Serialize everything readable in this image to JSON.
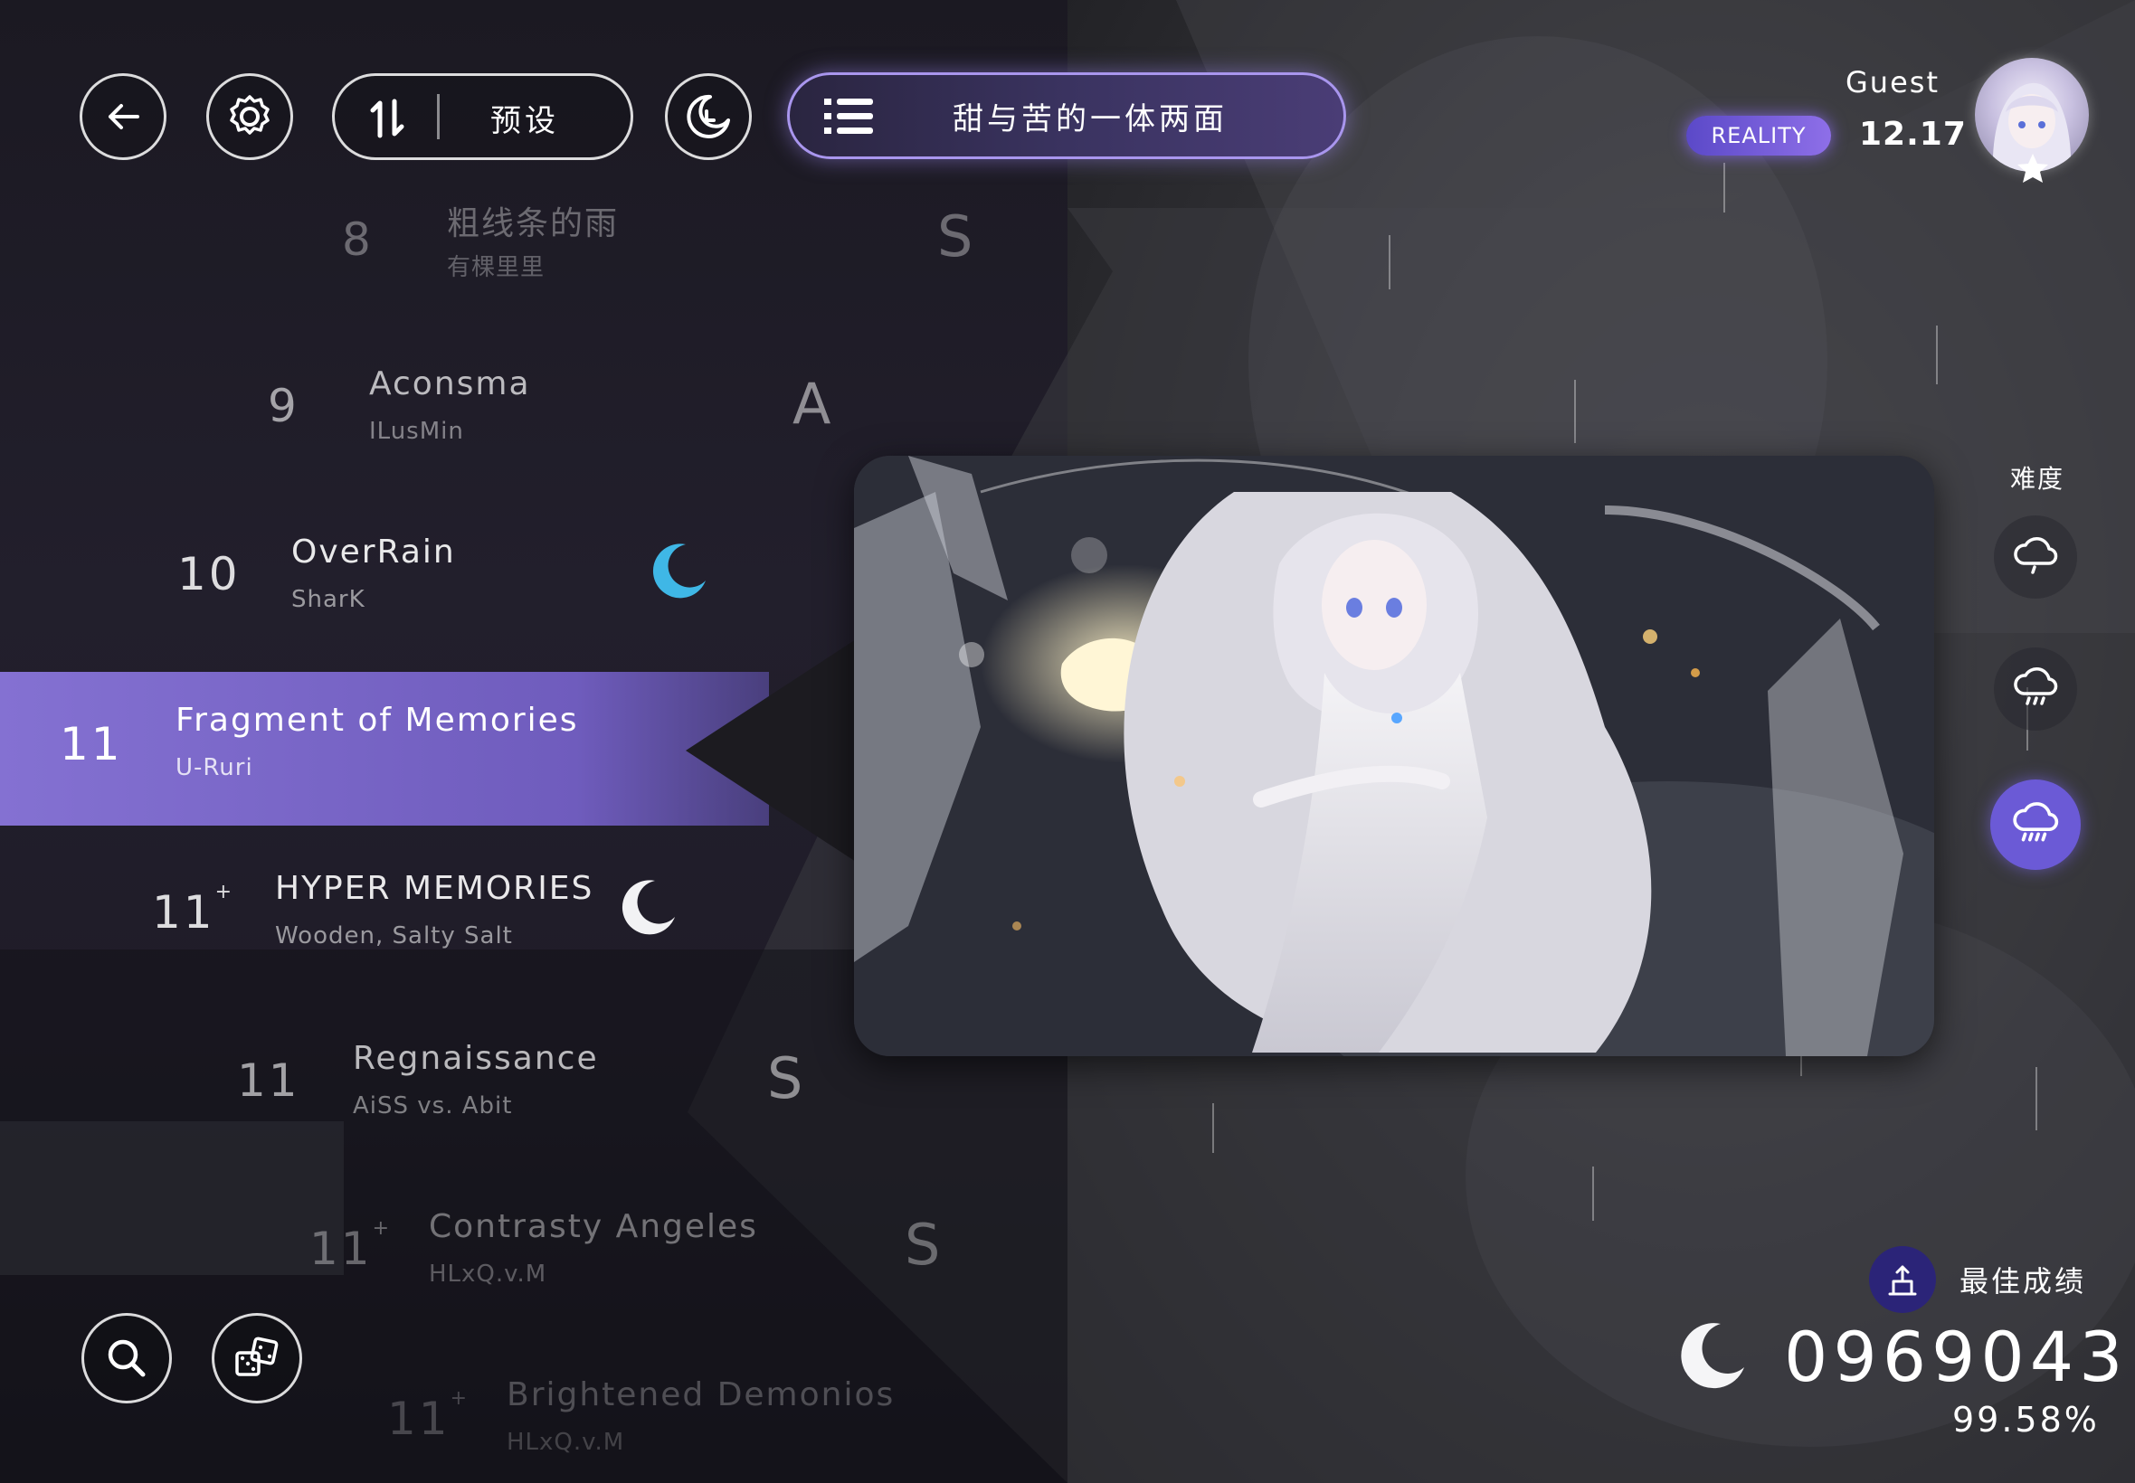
{
  "header": {
    "sort_label": "预设",
    "collection_title": "甜与苦的一体两面"
  },
  "player": {
    "name": "Guest",
    "badge": "REALITY",
    "rating": "12.17"
  },
  "songs": [
    {
      "level": "8",
      "plus": "",
      "title": "粗线条的雨",
      "artist": "有棵里里",
      "rank": "S"
    },
    {
      "level": "9",
      "plus": "",
      "title": "Aconsma",
      "artist": "ILusMin",
      "rank": "A"
    },
    {
      "level": "10",
      "plus": "",
      "title": "OverRain",
      "artist": "SharK",
      "rank": ""
    },
    {
      "level": "11",
      "plus": "",
      "title": "Fragment of Memories",
      "artist": "U-Ruri",
      "rank": ""
    },
    {
      "level": "11",
      "plus": "+",
      "title": "HYPER MEMORIES",
      "artist": "Wooden, Salty Salt",
      "rank": ""
    },
    {
      "level": "11",
      "plus": "",
      "title": "Regnaissance",
      "artist": "AiSS vs. Abit",
      "rank": "S"
    },
    {
      "level": "11",
      "plus": "+",
      "title": "Contrasty Angeles",
      "artist": "HLxQ.v.M",
      "rank": "S"
    },
    {
      "level": "11",
      "plus": "+",
      "title": "Brightened Demonios",
      "artist": "HLxQ.v.M",
      "rank": ""
    }
  ],
  "difficulty": {
    "label": "难度",
    "options": [
      "drizzle",
      "rain",
      "storm"
    ],
    "selected": "storm"
  },
  "best": {
    "label": "最佳成绩",
    "score": "0969043",
    "accuracy": "99.58%"
  },
  "icons": {
    "back": "back-arrow-icon",
    "settings": "gear-icon",
    "sort": "sort-icon",
    "mood": "moon-clock-icon",
    "list": "list-icon",
    "search": "search-icon",
    "random": "dice-icon",
    "cleared": "crescent-moon-icon"
  },
  "colors": {
    "accent": "#8c78d6",
    "selected_row": "#7c66c4",
    "moon_blue": "#3fb7e6",
    "diff_active": "#6b5ad6"
  }
}
